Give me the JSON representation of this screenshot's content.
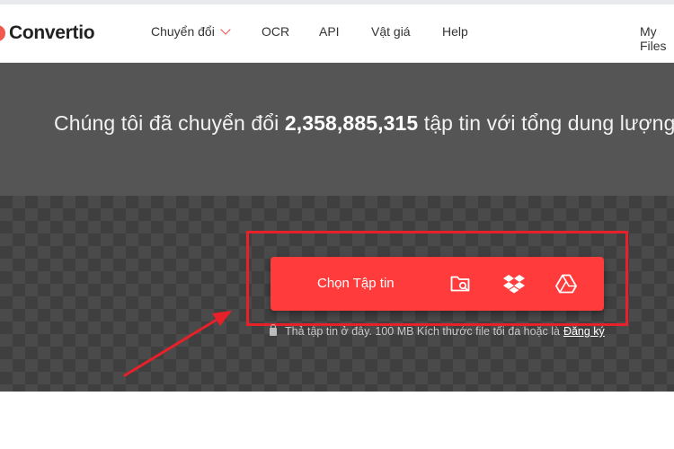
{
  "brand": {
    "name": "Convertio"
  },
  "nav": {
    "items": [
      {
        "label": "Chuyển đổi",
        "has_dropdown": true
      },
      {
        "label": "OCR"
      },
      {
        "label": "API"
      },
      {
        "label": "Vật giá"
      },
      {
        "label": "Help"
      },
      {
        "label": "My Files"
      }
    ]
  },
  "hero": {
    "text_before": "Chúng tôi đã chuyển đổi ",
    "count": "2,358,885,315",
    "text_after": " tập tin với tổng dung lượng"
  },
  "upload": {
    "label": "Chọn Tập tin",
    "icons": [
      "folder-search-icon",
      "dropbox-icon",
      "google-drive-icon"
    ]
  },
  "hint": {
    "text": "Thả tập tin ở đây. 100 MB Kích thước file tối đa hoặc là",
    "link": "Đăng ký"
  },
  "colors": {
    "accent": "#ff3b3b",
    "annotation": "#e8202a",
    "hero_dark": "#555555",
    "hero_checker": "#3f3f3f"
  }
}
